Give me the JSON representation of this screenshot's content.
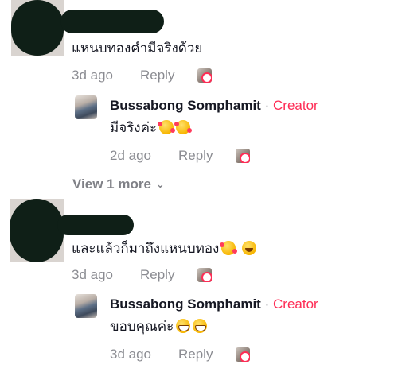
{
  "comments": [
    {
      "text": "แหนบทองคำมีจริงด้วย",
      "time": "3d ago",
      "reply_label": "Reply",
      "reply": {
        "author": "Bussabong Somphamit",
        "separator": "·",
        "badge": "Creator",
        "text": "มีจริงค่ะ",
        "emojis": [
          "smiling-face-with-hearts-icon",
          "smiling-face-with-hearts-icon"
        ],
        "time": "2d ago",
        "reply_label": "Reply"
      },
      "view_more": "View 1 more"
    },
    {
      "text": "และแล้วก็มาถึงแหนบทอง",
      "emojis": [
        "smiling-face-with-hearts-icon",
        "grinning-face-icon"
      ],
      "time": "3d ago",
      "reply_label": "Reply",
      "reply": {
        "author": "Bussabong Somphamit",
        "separator": "·",
        "badge": "Creator",
        "text": "ขอบคุณค่ะ",
        "emojis": [
          "beaming-face-icon",
          "beaming-face-icon"
        ],
        "time": "3d ago",
        "reply_label": "Reply"
      }
    }
  ],
  "colors": {
    "creator": "#fe2c55",
    "meta": "#8a8b91",
    "redaction": "#0f1f17"
  }
}
